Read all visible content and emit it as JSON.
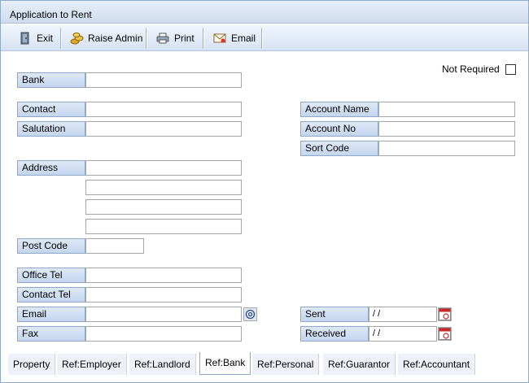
{
  "window": {
    "title": "Application to Rent"
  },
  "toolbar": {
    "exit": "Exit",
    "raise_admin": "Raise Admin",
    "print": "Print",
    "email": "Email"
  },
  "not_required": {
    "label": "Not Required",
    "checked": false
  },
  "labels": {
    "bank": "Bank",
    "contact": "Contact",
    "salutation": "Salutation",
    "address": "Address",
    "post_code": "Post Code",
    "office_tel": "Office Tel",
    "contact_tel": "Contact Tel",
    "email": "Email",
    "fax": "Fax",
    "account_name": "Account Name",
    "account_no": "Account No",
    "sort_code": "Sort Code",
    "sent": "Sent",
    "received": "Received"
  },
  "values": {
    "bank": "",
    "contact": "",
    "salutation": "",
    "address1": "",
    "address2": "",
    "address3": "",
    "address4": "",
    "post_code": "",
    "office_tel": "",
    "contact_tel": "",
    "email": "",
    "fax": "",
    "account_name": "",
    "account_no": "",
    "sort_code": "",
    "sent": " / /",
    "received": " / /"
  },
  "tabs": [
    "Property",
    "Ref:Employer",
    "Ref:Landlord",
    "Ref:Bank",
    "Ref:Personal",
    "Ref:Guarantor",
    "Ref:Accountant"
  ],
  "active_tab": "Ref:Bank",
  "icons": {
    "exit": "door-icon",
    "raise_admin": "coins-icon",
    "print": "printer-icon",
    "email": "envelope-icon",
    "email_field": "at-sign-icon",
    "calendar": "calendar-icon"
  }
}
